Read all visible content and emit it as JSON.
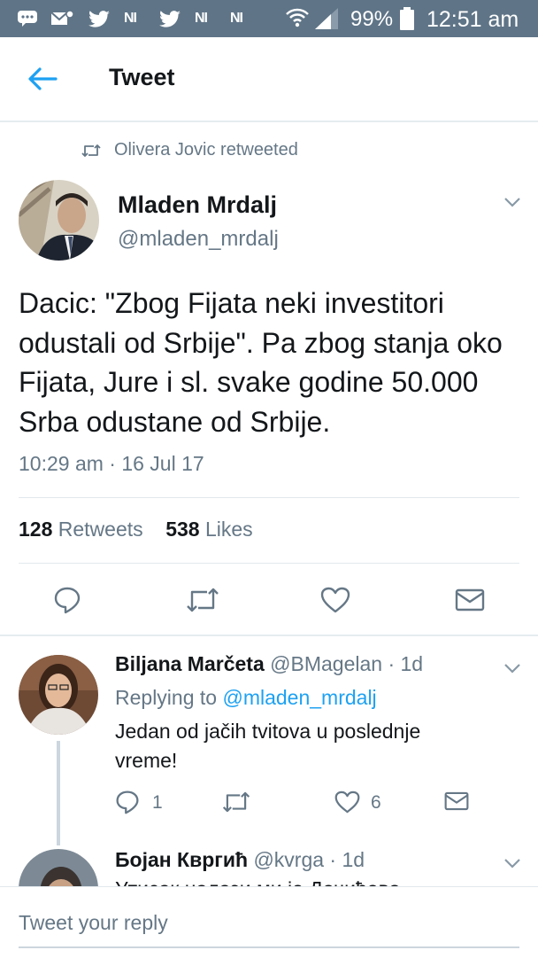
{
  "status_bar": {
    "carrier_marks": [
      "NI",
      "NI",
      "NI"
    ],
    "battery_percent": "99%",
    "time": "12:51 am",
    "background": "#5f7487"
  },
  "header": {
    "title": "Tweet",
    "accent_color": "#1da1f2"
  },
  "tweet": {
    "retweeted_by": "Olivera Jovic retweeted",
    "author_name": "Mladen Mrdalj",
    "author_handle": "@mladen_mrdalj",
    "text": "Dacic: \"Zbog Fijata neki investitori odustali od Srbije\". Pa zbog stanja oko Fijata, Jure i sl. svake godine 50.000 Srba odustane od Srbije.",
    "timestamp": "10:29 am · 16 Jul 17",
    "retweet_count": "128",
    "retweet_label": "Retweets",
    "like_count": "538",
    "like_label": "Likes",
    "actions": [
      "reply-icon",
      "retweet-icon",
      "heart-icon",
      "mail-icon"
    ]
  },
  "replies": [
    {
      "name": "Biljana Marčeta",
      "handle": "@BMagelan · 1d",
      "replying_prefix": "Replying to",
      "replying_to": "@mladen_mrdalj",
      "text": "Jedan od jačih tvitova u poslednje vreme!",
      "reply_count": "1",
      "like_count": "6"
    },
    {
      "name": "Бојан Квргић",
      "handle": "@kvrga · 1d",
      "text_partial": "Утисак налази ми је Дачићево"
    }
  ],
  "compose": {
    "placeholder": "Tweet your reply"
  }
}
